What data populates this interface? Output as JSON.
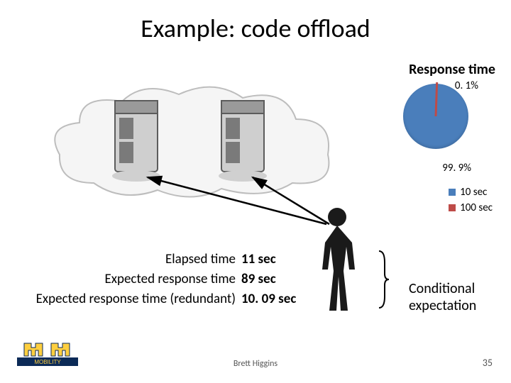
{
  "title": "Example: code offload",
  "response_time_label": "Response time",
  "pie": {
    "label_top": "0. 1%",
    "label_bottom": "99. 9%"
  },
  "legend": {
    "items": [
      {
        "label": "10 sec",
        "color": "#4a7ebb"
      },
      {
        "label": "100 sec",
        "color": "#be4b48"
      }
    ]
  },
  "stats": {
    "rows": [
      {
        "label": "Elapsed time",
        "value": "11 sec"
      },
      {
        "label": "Expected response time",
        "value": "89 sec"
      },
      {
        "label": "Expected response time (redundant)",
        "value": "10. 09 sec"
      }
    ]
  },
  "conditional_label": "Conditional expectation",
  "footer": {
    "author": "Brett Higgins",
    "page": "35",
    "logo_text": "MOBILITY"
  },
  "chart_data": {
    "type": "pie",
    "title": "Response time",
    "series": [
      {
        "name": "10 sec",
        "value": 99.9,
        "color": "#4a7ebb"
      },
      {
        "name": "100 sec",
        "value": 0.1,
        "color": "#be4b48"
      }
    ]
  }
}
